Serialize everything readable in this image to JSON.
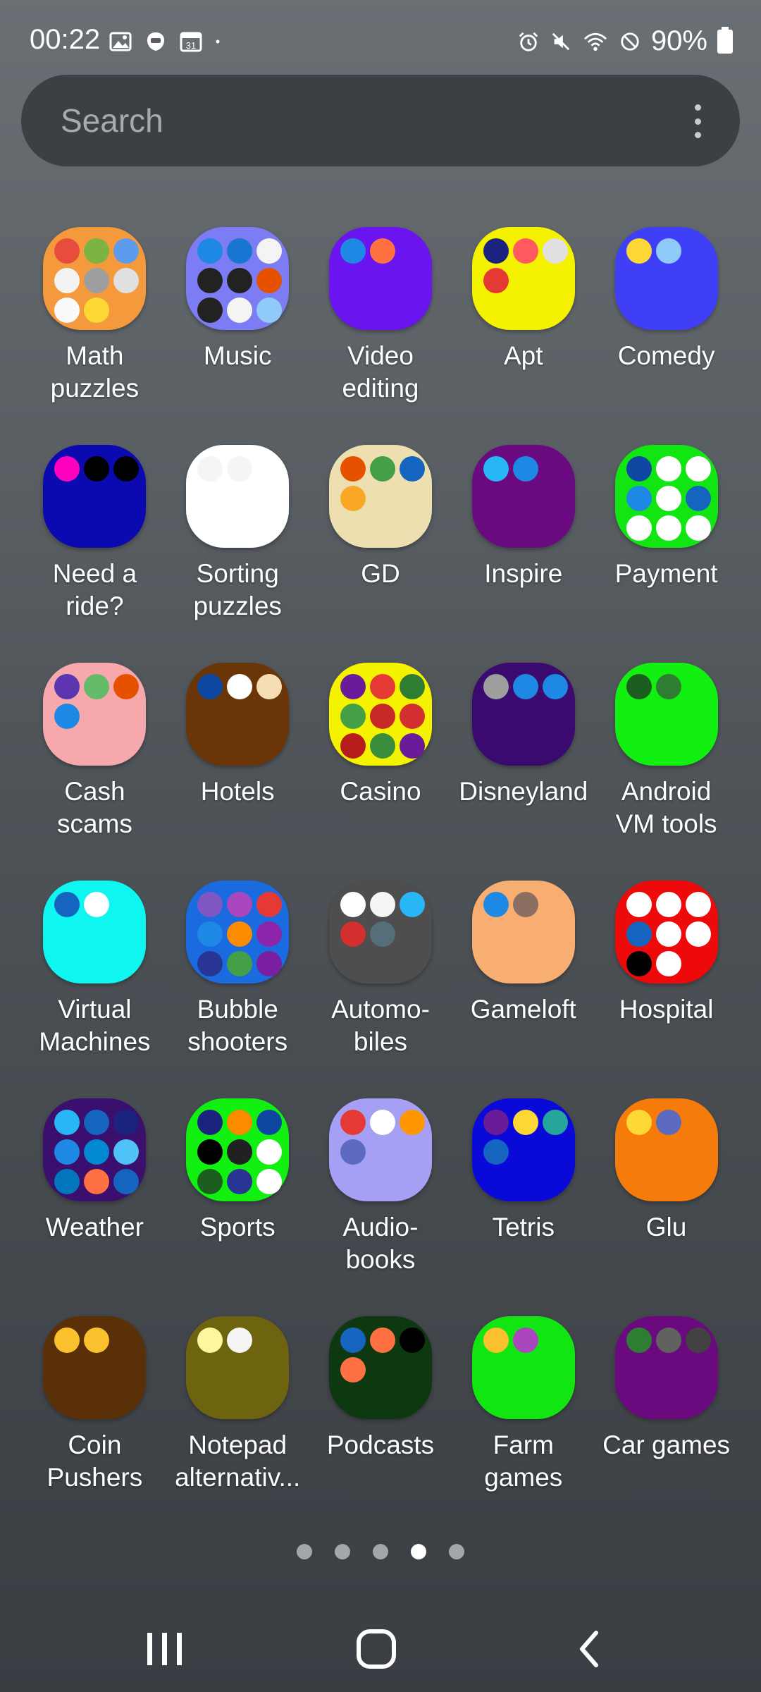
{
  "status_bar": {
    "time": "00:22",
    "left_icons": [
      "gallery-icon",
      "messenger-icon",
      "calendar-icon",
      "dot-icon"
    ],
    "calendar_day": "31",
    "right_icons": [
      "alarm-icon",
      "mute-icon",
      "wifi-icon",
      "do-not-disturb-icon"
    ],
    "battery": "90%"
  },
  "search": {
    "placeholder": "Search"
  },
  "folders": [
    {
      "label": "Math\npuzzles",
      "color": "#f59a3c",
      "apps": [
        "#e84c3d",
        "#7cb342",
        "#5d9cec",
        "#f2f2f2",
        "#9e9e9e",
        "#e0e0e0",
        "#fafafa",
        "#fdd835"
      ]
    },
    {
      "label": "Music",
      "color": "#7c7cf5",
      "apps": [
        "#1e88e5",
        "#1976d2",
        "#f4f4f4",
        "#222222",
        "#222222",
        "#e65100",
        "#222222",
        "#f5f5f5",
        "#90caf9"
      ]
    },
    {
      "label": "Video\nediting",
      "color": "#6a14f0",
      "apps": [
        "#1e88e5",
        "#ff7043"
      ]
    },
    {
      "label": "Apt",
      "color": "#f5f200",
      "apps": [
        "#1a237e",
        "#ff5a5f",
        "#e0e0e0",
        "#e53935"
      ]
    },
    {
      "label": "Comedy",
      "color": "#3f3ff7",
      "apps": [
        "#fdd835",
        "#90caf9"
      ]
    },
    {
      "label": "Need a\nride?",
      "color": "#0a0ab0",
      "apps": [
        "#ff00bf",
        "#000000",
        "#000000"
      ]
    },
    {
      "label": "Sorting\npuzzles",
      "color": "#ffffff",
      "apps": [
        "#f5f5f5",
        "#f5f5f5"
      ]
    },
    {
      "label": "GD",
      "color": "#eedfb0",
      "apps": [
        "#e65100",
        "#43a047",
        "#1565c0",
        "#f9a825"
      ]
    },
    {
      "label": "Inspire",
      "color": "#6a0a80",
      "apps": [
        "#29b6f6",
        "#1e88e5"
      ]
    },
    {
      "label": "Payment",
      "color": "#12e612",
      "apps": [
        "#0d47a1",
        "#ffffff",
        "#ffffff",
        "#1e88e5",
        "#ffffff",
        "#1565c0",
        "#ffffff",
        "#ffffff",
        "#ffffff"
      ]
    },
    {
      "label": "Cash\nscams",
      "color": "#f7a8ad",
      "apps": [
        "#5e35b1",
        "#66bb6a",
        "#e65100",
        "#1e88e5"
      ]
    },
    {
      "label": "Hotels",
      "color": "#6a3608",
      "apps": [
        "#0d47a1",
        "#ffffff",
        "#f5deb3"
      ]
    },
    {
      "label": "Casino",
      "color": "#f5f200",
      "apps": [
        "#6a1b9a",
        "#e53935",
        "#2e7d32",
        "#43a047",
        "#c62828",
        "#d32f2f",
        "#b71c1c",
        "#388e3c",
        "#6a1b9a"
      ]
    },
    {
      "label": "Disneyland",
      "color": "#3a0a6e",
      "apps": [
        "#9e9e9e",
        "#1e88e5",
        "#1e88e5"
      ]
    },
    {
      "label": "Android\nVM tools",
      "color": "#12f012",
      "apps": [
        "#1b5e20",
        "#2e7d32"
      ]
    },
    {
      "label": "Virtual\nMachines",
      "color": "#0ff5f0",
      "apps": [
        "#1565c0",
        "#ffffff"
      ]
    },
    {
      "label": "Bubble\nshooters",
      "color": "#1a6ae0",
      "apps": [
        "#7e57c2",
        "#ab47bc",
        "#e53935",
        "#1e88e5",
        "#fb8c00",
        "#8e24aa",
        "#283593",
        "#43a047",
        "#7b1fa2"
      ]
    },
    {
      "label": "Automo-\nbiles",
      "color": "#4e4e4e",
      "apps": [
        "#ffffff",
        "#f5f5f5",
        "#29b6f6",
        "#d32f2f",
        "#546e7a"
      ]
    },
    {
      "label": "Gameloft",
      "color": "#f8ae70",
      "apps": [
        "#1e88e5",
        "#8d6e63"
      ]
    },
    {
      "label": "Hospital",
      "color": "#ee0a0a",
      "apps": [
        "#ffffff",
        "#ffffff",
        "#ffffff",
        "#1565c0",
        "#ffffff",
        "#ffffff",
        "#000000",
        "#ffffff"
      ]
    },
    {
      "label": "Weather",
      "color": "#3a0f6e",
      "apps": [
        "#29b6f6",
        "#1565c0",
        "#1a237e",
        "#1e88e5",
        "#0288d1",
        "#4fc3f7",
        "#0277bd",
        "#ff7043",
        "#1565c0"
      ]
    },
    {
      "label": "Sports",
      "color": "#12f012",
      "apps": [
        "#1a237e",
        "#fb8c00",
        "#0d47a1",
        "#000000",
        "#212121",
        "#ffffff",
        "#1b5e20",
        "#283593",
        "#ffffff"
      ]
    },
    {
      "label": "Audio-\nbooks",
      "color": "#a6a0f5",
      "apps": [
        "#e53935",
        "#ffffff",
        "#ff9800",
        "#5c6bc0"
      ]
    },
    {
      "label": "Tetris",
      "color": "#0a0ad8",
      "apps": [
        "#6a1b9a",
        "#fdd835",
        "#26a69a",
        "#1565c0"
      ]
    },
    {
      "label": "Glu",
      "color": "#f57c0a",
      "apps": [
        "#fdd835",
        "#5c6bc0"
      ]
    },
    {
      "label": "Coin\nPushers",
      "color": "#5a3008",
      "apps": [
        "#fbc02d",
        "#fbc02d"
      ]
    },
    {
      "label": "Notepad\nalternativ...",
      "color": "#6e6410",
      "apps": [
        "#fff59d",
        "#f5f5f5"
      ]
    },
    {
      "label": "Podcasts",
      "color": "#0e3810",
      "apps": [
        "#1565c0",
        "#ff7043",
        "#000000",
        "#ff7043"
      ]
    },
    {
      "label": "Farm\ngames",
      "color": "#12e612",
      "apps": [
        "#fbc02d",
        "#ab47bc"
      ]
    },
    {
      "label": "Car games",
      "color": "#6a0a7e",
      "apps": [
        "#2e7d32",
        "#616161",
        "#424242"
      ]
    }
  ],
  "page_indicator": {
    "count": 5,
    "active": 3
  },
  "nav": {
    "recent": "recent-apps-icon",
    "home": "home-icon",
    "back": "back-icon"
  }
}
